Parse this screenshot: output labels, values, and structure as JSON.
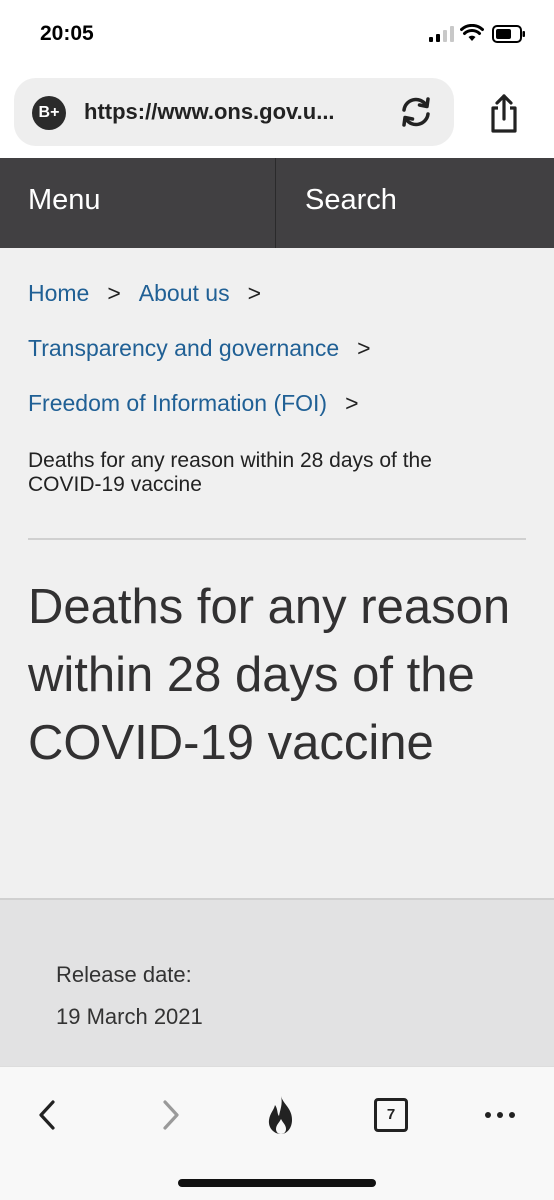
{
  "status_bar": {
    "time": "20:05"
  },
  "browser": {
    "badge": "B+",
    "url": "https://www.ons.gov.u...",
    "tab_count": "7"
  },
  "nav": {
    "menu_label": "Menu",
    "search_label": "Search"
  },
  "breadcrumb": {
    "items": [
      {
        "label": "Home"
      },
      {
        "label": "About us"
      },
      {
        "label": "Transparency and governance"
      },
      {
        "label": "Freedom of Information (FOI)"
      }
    ],
    "separator": ">",
    "current": "Deaths for any reason within 28 days of the COVID-19 vaccine"
  },
  "page": {
    "title": "Deaths for any reason within 28 days of the COVID-19 vaccine",
    "release_label": "Release date:",
    "release_date": "19 March 2021"
  },
  "colors": {
    "link": "#206095",
    "nav_bg": "#414042"
  },
  "icons": [
    "signal-icon",
    "wifi-icon",
    "battery-icon",
    "reload-icon",
    "share-icon",
    "back-icon",
    "forward-icon",
    "flame-icon",
    "more-icon"
  ]
}
